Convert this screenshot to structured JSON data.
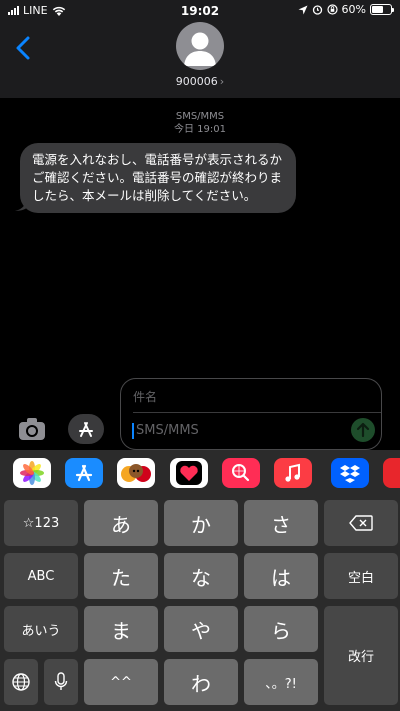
{
  "status_bar": {
    "carrier": "LINE",
    "time": "19:02",
    "battery_text": "60%",
    "battery_level": 0.6
  },
  "header": {
    "contact": "900006",
    "chevron": "›"
  },
  "conversation": {
    "service": "SMS/MMS",
    "timestamp": "今日 19:01",
    "message_lines": [
      "電源を入れなおし、電話番号が表示されるか",
      "ご確認ください。電話番号の確認が終わりま",
      "したら、本メールは削除してください。"
    ]
  },
  "compose": {
    "subject_placeholder": "件名",
    "body_placeholder": "SMS/MMS"
  },
  "app_strip": [
    {
      "name": "photos-app-icon",
      "color": "#ffffff"
    },
    {
      "name": "app-store-app-icon",
      "color": "#1a8cff"
    },
    {
      "name": "memoji-app-icon",
      "color": "#ffffff"
    },
    {
      "name": "digital-touch-app-icon",
      "color": "#ffffff"
    },
    {
      "name": "images-search-app-icon",
      "color": "#ff2d55"
    },
    {
      "name": "music-app-icon",
      "color": "#fc3c44"
    },
    {
      "name": "dropbox-app-icon",
      "color": "#0061fe"
    },
    {
      "name": "partial-app-icon",
      "color": "#e8262c"
    }
  ],
  "keyboard": {
    "num_key": "☆123",
    "abc_key": "ABC",
    "aiu_key": "あいう",
    "space_key": "空白",
    "return_key": "改行",
    "kana": [
      "あ",
      "か",
      "さ",
      "た",
      "な",
      "は",
      "ま",
      "や",
      "ら"
    ],
    "daku_key": "^^",
    "wa_key": "わ",
    "punct_key": "、。?!"
  },
  "colors": {
    "accent": "#0a84ff",
    "bubble": "#3a3a3c",
    "header_bg": "#1c1c1e"
  }
}
